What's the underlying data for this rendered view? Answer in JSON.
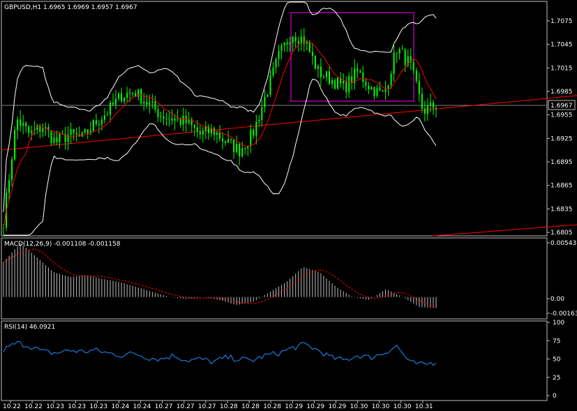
{
  "main_pane": {
    "title": "GBPUSD,H1  1.6965 1.6969 1.6957 1.6967",
    "y_ticks": [
      "1.7075",
      "1.7045",
      "1.7015",
      "1.6985",
      "1.6955",
      "1.6925",
      "1.6895",
      "1.6865",
      "1.6835",
      "1.6805"
    ],
    "current_price": "1.6967"
  },
  "macd_pane": {
    "title": "MACD(12,26,9)  -0.001108  -0.001158",
    "y_ticks": [
      "0.00543",
      "0.00",
      "-0.00163"
    ]
  },
  "rsi_pane": {
    "title": "RSI(14)  46.0921",
    "y_ticks": [
      "100",
      "75",
      "50",
      "25",
      "0"
    ]
  },
  "x_ticks": [
    "10.22",
    "10.22",
    "10.23",
    "10.23",
    "10.23",
    "10.24",
    "10.24",
    "10.27",
    "10.27",
    "10.27",
    "10.28",
    "10.28",
    "10.28",
    "10.29",
    "10.29",
    "10.29",
    "10.30",
    "10.30",
    "10.30",
    "10.31"
  ],
  "colors": {
    "background": "#000000",
    "candles": "#00ff00",
    "ma": "#ff0000",
    "bands": "#ffffff",
    "trendline": "#ff0000",
    "macd_hist": "#c0c0c0",
    "macd_signal": "#ff0000",
    "rsi": "#1e90ff",
    "highlight_box": "#ff00ff",
    "axis": "#c0c0c0"
  },
  "chart_data": {
    "type": "line",
    "series": [
      {
        "name": "GBPUSD,H1",
        "y": [
          1.682,
          1.695,
          1.693,
          1.694,
          1.692,
          1.693,
          1.6925,
          1.6945,
          1.696,
          1.698,
          1.6985,
          1.697,
          1.6955,
          1.695,
          1.6945,
          1.693,
          1.6935,
          1.692,
          1.691,
          1.693,
          1.698,
          1.703,
          1.706,
          1.705,
          1.701,
          1.7,
          1.699,
          1.701,
          1.699,
          1.698,
          1.704,
          1.702,
          1.696,
          1.6967
        ]
      },
      {
        "name": "MACD(12,26,9)",
        "y": [
          0.0035,
          0.0054,
          0.004,
          0.0025,
          0.002,
          0.0022,
          0.0018,
          0.0015,
          0.001,
          0.0005,
          0.0,
          -0.0002,
          0.0,
          -0.0003,
          -0.0008,
          -0.0005,
          0.0005,
          0.0015,
          0.003,
          0.0025,
          0.001,
          0.0,
          -0.0003,
          0.0008,
          0.0,
          -0.001,
          -0.0011
        ]
      },
      {
        "name": "RSI(14)",
        "y": [
          62,
          72,
          68,
          60,
          58,
          62,
          60,
          62,
          58,
          55,
          58,
          52,
          50,
          55,
          48,
          50,
          46,
          52,
          50,
          48,
          55,
          58,
          65,
          70,
          62,
          52,
          48,
          55,
          52,
          58,
          68,
          45,
          42,
          46
        ]
      }
    ]
  }
}
